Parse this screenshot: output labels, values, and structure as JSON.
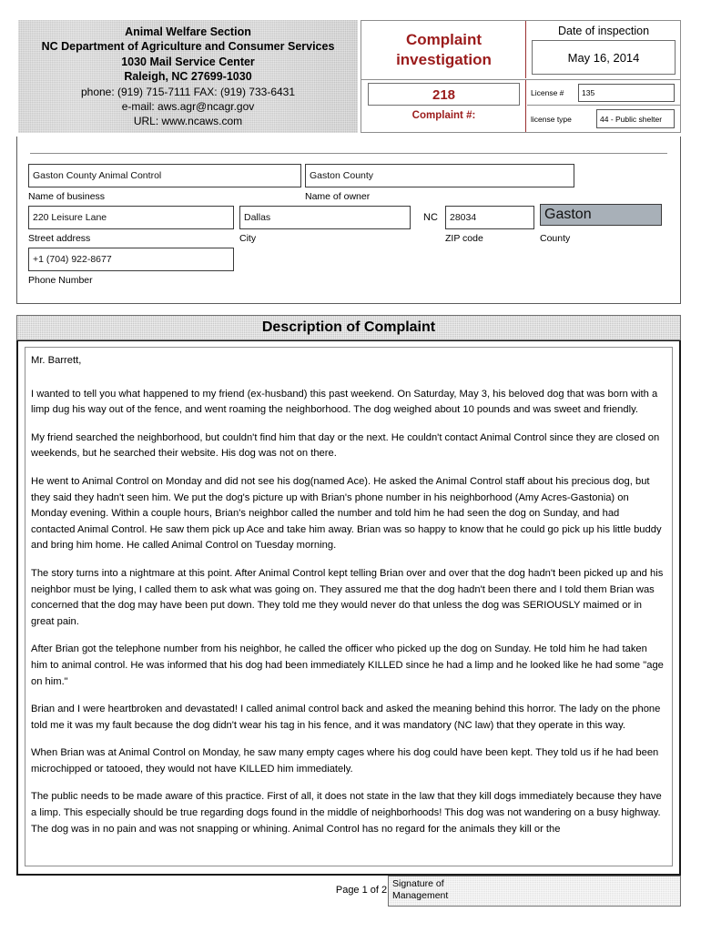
{
  "agency": {
    "name": "Animal Welfare Section",
    "department": "NC Department of Agriculture and Consumer Services",
    "address": "1030 Mail Service Center",
    "city_state_zip": "Raleigh, NC 27699-1030",
    "phone_fax": "phone: (919) 715-7111        FAX: (919) 733-6431",
    "email": "e-mail:  aws.agr@ncagr.gov",
    "url": "URL: www.ncaws.com"
  },
  "form_header": {
    "title_line1": "Complaint",
    "title_line2": "investigation",
    "date_label": "Date of inspection",
    "date_value": "May 16, 2014",
    "complaint_number": "218",
    "complaint_number_label": "Complaint #:",
    "license_number_label": "License #",
    "license_number_value": "135",
    "license_type_label": "license type",
    "license_type_value": "44 - Public shelter",
    "accent_color": "#9b1b1b"
  },
  "business_info": {
    "business_name_value": "Gaston County Animal Control",
    "business_name_label": "Name of business",
    "owner_name_value": "Gaston County",
    "owner_name_label": "Name of owner",
    "street_value": "220 Leisure Lane",
    "street_label": "Street address",
    "city_value": "Dallas",
    "city_label": "City",
    "state_value": "NC",
    "zip_value": "28034",
    "zip_label": "ZIP code",
    "county_value": "Gaston",
    "county_label": "County",
    "county_highlight_color": "#a8b0b8",
    "phone_value": "+1 (704) 922-8677",
    "phone_label": "Phone Number"
  },
  "description": {
    "section_title": "Description of Complaint",
    "paragraphs": [
      "Mr. Barrett,",
      "I wanted to tell you what happened to my friend (ex-husband) this  past weekend. On Saturday, May 3, his beloved dog that was born with a limp dug his way out of the fence, and went roaming the neighborhood. The dog weighed about 10 pounds and was sweet and friendly.",
      "My friend searched the neighborhood, but couldn't find him that day or the next. He couldn't contact Animal Control since they are closed on weekends, but he searched their website. His dog was not on there.",
      "He went to Animal Control on Monday and did not see his dog(named Ace). He asked the Animal Control staff about his precious dog, but they said they hadn't seen him. We put the dog's picture up with Brian's phone number in his neighborhood  (Amy Acres-Gastonia) on Monday evening. Within a couple hours, Brian's neighbor called the number and told him he had seen the dog on Sunday, and had contacted Animal Control. He saw them pick up Ace and take him away. Brian was so happy to know that he could go pick up his little buddy and bring him home.  He called Animal Control on Tuesday morning.",
      "The story turns into a nightmare at this point. After Animal Control kept telling Brian over and over that the dog hadn't been picked up and his neighbor must be lying, I called them to ask what was going on. They assured me that the dog hadn't been there and I told them Brian was concerned that the dog may have been put down. They told me they would never do that unless the dog was SERIOUSLY maimed or in great pain.",
      "After Brian got the telephone number from his neighbor, he called the officer who picked up the dog on Sunday. He told him he had taken him to animal control. He was informed that his dog had been immediately KILLED since he had a limp and he looked like he had some \"age on him.\"",
      "Brian and I were heartbroken and devastated! I called animal control back and asked the meaning behind this horror. The lady on the phone told me it was my fault because the dog didn't wear his tag in his fence, and it was mandatory (NC law) that they operate in this way.",
      "When Brian was at Animal Control on Monday, he saw many empty cages where his dog could have been kept. They told us if he had been microchipped or tatooed, they would not have KILLED him immediately.",
      "The public needs to be made aware of this practice. First of all, it does not state in the law that they kill dogs immediately because they have a limp. This especially should be true regarding dogs found in the middle of neighborhoods! This dog was not wandering on a busy highway. The dog was in no pain and was not snapping or whining. Animal Control has no regard for the animals they kill or the"
    ]
  },
  "footer": {
    "page_number": "Page 1 of 2",
    "signature_label_line1": "Signature of",
    "signature_label_line2": "Management"
  }
}
